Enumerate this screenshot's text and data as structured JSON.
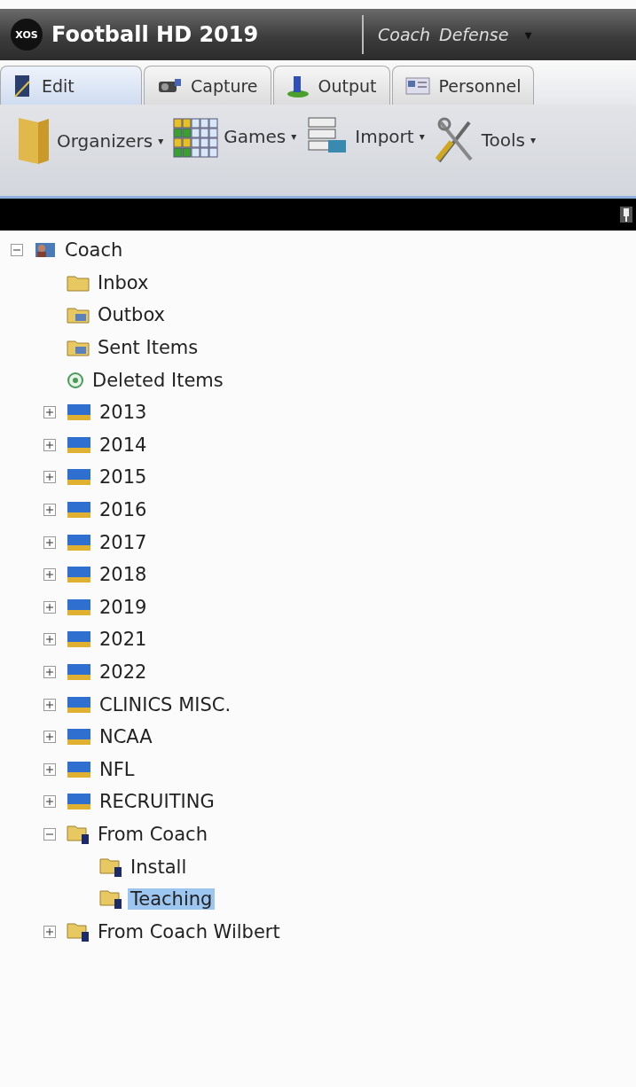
{
  "app": {
    "logo": "XOS",
    "title": "Football HD 2019",
    "user": "Coach",
    "role": "Defense",
    "menu_caret": "▾"
  },
  "tabs": [
    {
      "label": "Edit",
      "kind": "edit",
      "selected": true
    },
    {
      "label": "Capture",
      "kind": "capture",
      "selected": false
    },
    {
      "label": "Output",
      "kind": "output",
      "selected": false
    },
    {
      "label": "Personnel",
      "kind": "personnel",
      "selected": false
    }
  ],
  "toolbar": [
    {
      "label": "Organizers",
      "kind": "organizers",
      "caret": "▾"
    },
    {
      "label": "Games",
      "kind": "games",
      "caret": "▾"
    },
    {
      "label": "Import",
      "kind": "import",
      "caret": "▾"
    },
    {
      "label": "Tools",
      "kind": "tools",
      "caret": "▾"
    }
  ],
  "tree": [
    {
      "label": "Coach",
      "kind": "account",
      "expanded": true,
      "selected": false,
      "children": [
        {
          "label": "Inbox",
          "kind": "inbox",
          "selected": false
        },
        {
          "label": "Outbox",
          "kind": "outbox",
          "selected": false
        },
        {
          "label": "Sent Items",
          "kind": "sent",
          "selected": false
        },
        {
          "label": "Deleted Items",
          "kind": "deleted",
          "selected": false
        },
        {
          "label": "2013",
          "kind": "year",
          "expanded": false,
          "selected": false
        },
        {
          "label": "2014",
          "kind": "year",
          "expanded": false,
          "selected": false
        },
        {
          "label": "2015",
          "kind": "year",
          "expanded": false,
          "selected": false
        },
        {
          "label": "2016",
          "kind": "year",
          "expanded": false,
          "selected": false
        },
        {
          "label": "2017",
          "kind": "year",
          "expanded": false,
          "selected": false
        },
        {
          "label": "2018",
          "kind": "year",
          "expanded": false,
          "selected": false
        },
        {
          "label": "2019",
          "kind": "year",
          "expanded": false,
          "selected": false
        },
        {
          "label": "2021",
          "kind": "year",
          "expanded": false,
          "selected": false
        },
        {
          "label": "2022",
          "kind": "year",
          "expanded": false,
          "selected": false
        },
        {
          "label": "CLINICS MISC.",
          "kind": "year",
          "expanded": false,
          "selected": false
        },
        {
          "label": "NCAA",
          "kind": "year",
          "expanded": false,
          "selected": false
        },
        {
          "label": "NFL",
          "kind": "year",
          "expanded": false,
          "selected": false
        },
        {
          "label": "RECRUITING",
          "kind": "year",
          "expanded": false,
          "selected": false
        },
        {
          "label": "From Coach",
          "kind": "shared",
          "expanded": true,
          "selected": false,
          "children": [
            {
              "label": "Install",
              "kind": "shared",
              "selected": false
            },
            {
              "label": "Teaching",
              "kind": "shared",
              "selected": true
            }
          ]
        },
        {
          "label": "From Coach Wilbert",
          "kind": "shared",
          "expanded": false,
          "selected": false
        }
      ]
    }
  ]
}
